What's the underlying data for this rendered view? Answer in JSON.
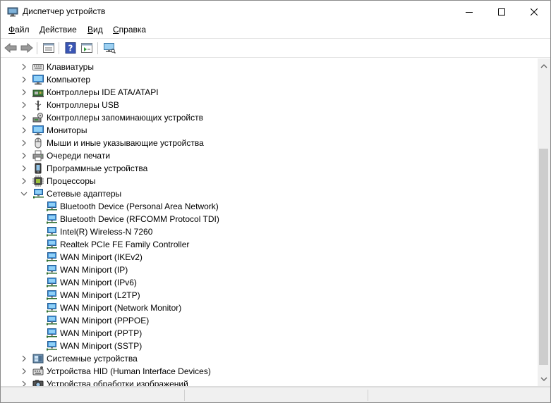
{
  "window": {
    "title": "Диспетчер устройств"
  },
  "menu": [
    {
      "label": "Файл",
      "accel": "Ф",
      "rest": "айл"
    },
    {
      "label": "Действие",
      "accel": "Д",
      "rest": "ействие"
    },
    {
      "label": "Вид",
      "accel": "В",
      "rest": "ид"
    },
    {
      "label": "Справка",
      "accel": "С",
      "rest": "правка"
    }
  ],
  "toolbar": {
    "icons": [
      "back-arrow-icon",
      "forward-arrow-icon",
      "properties-icon",
      "help-icon",
      "view-icon",
      "scan-hardware-icon"
    ]
  },
  "tree": {
    "categories_top": [
      {
        "label": "Клавиатуры",
        "icon": "keyboard-icon"
      },
      {
        "label": "Компьютер",
        "icon": "computer-icon"
      },
      {
        "label": "Контроллеры IDE ATA/ATAPI",
        "icon": "ide-controller-icon"
      },
      {
        "label": "Контроллеры USB",
        "icon": "usb-icon"
      },
      {
        "label": "Контроллеры запоминающих устройств",
        "icon": "storage-controller-icon"
      },
      {
        "label": "Мониторы",
        "icon": "monitor-icon"
      },
      {
        "label": "Мыши и иные указывающие устройства",
        "icon": "mouse-icon"
      },
      {
        "label": "Очереди печати",
        "icon": "printer-icon"
      },
      {
        "label": "Программные устройства",
        "icon": "software-device-icon"
      },
      {
        "label": "Процессоры",
        "icon": "processor-icon"
      }
    ],
    "expanded": {
      "label": "Сетевые адаптеры",
      "icon": "network-adapter-icon",
      "children": [
        "Bluetooth Device (Personal Area Network)",
        "Bluetooth Device (RFCOMM Protocol TDI)",
        "Intel(R) Wireless-N 7260",
        "Realtek PCIe FE Family Controller",
        "WAN Miniport (IKEv2)",
        "WAN Miniport (IP)",
        "WAN Miniport (IPv6)",
        "WAN Miniport (L2TP)",
        "WAN Miniport (Network Monitor)",
        "WAN Miniport (PPPOE)",
        "WAN Miniport (PPTP)",
        "WAN Miniport (SSTP)"
      ]
    },
    "categories_bottom": [
      {
        "label": "Системные устройства",
        "icon": "system-device-icon"
      },
      {
        "label": "Устройства HID (Human Interface Devices)",
        "icon": "hid-device-icon"
      },
      {
        "label": "Устройства обработки изображений",
        "icon": "imaging-device-icon"
      }
    ]
  }
}
